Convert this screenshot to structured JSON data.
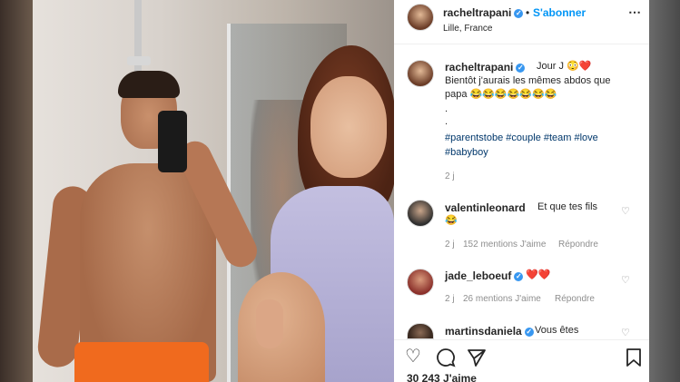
{
  "post": {
    "username": "racheltrapani",
    "follow_label": "S'abonner",
    "location": "Lille, France",
    "more_icon": "more-icon"
  },
  "caption": {
    "username": "racheltrapani",
    "line1": "Jour J 😳❤️",
    "line2": "Bientôt j'aurais les mêmes abdos que",
    "line3": "papa 😂😂😂😂😂😂😂",
    "dot1": ".",
    "dot2": ".",
    "hashtags1": "#parentstobe #couple #team #love",
    "hashtags2": "#babyboy",
    "time": "2 j"
  },
  "comments": [
    {
      "username": "valentinleonard",
      "text": "Et que tes fils",
      "text2": "😂",
      "time": "2 j",
      "likes": "152 mentions J'aime",
      "reply": "Répondre"
    },
    {
      "username": "jade_leboeuf",
      "text": "❤️❤️",
      "time": "2 j",
      "likes": "26 mentions J'aime",
      "reply": "Répondre"
    },
    {
      "username": "martinsdaniela",
      "text": "Vous êtes"
    }
  ],
  "actions": {
    "like_icon": "heart-icon",
    "comment_icon": "comment-icon",
    "share_icon": "share-icon",
    "save_icon": "bookmark-icon"
  },
  "likes_count": "30 243 J'aime",
  "colors": {
    "link_blue": "#0095f6",
    "hashtag": "#00376b",
    "verified": "#3897f0",
    "muted": "#8e8e8e"
  }
}
